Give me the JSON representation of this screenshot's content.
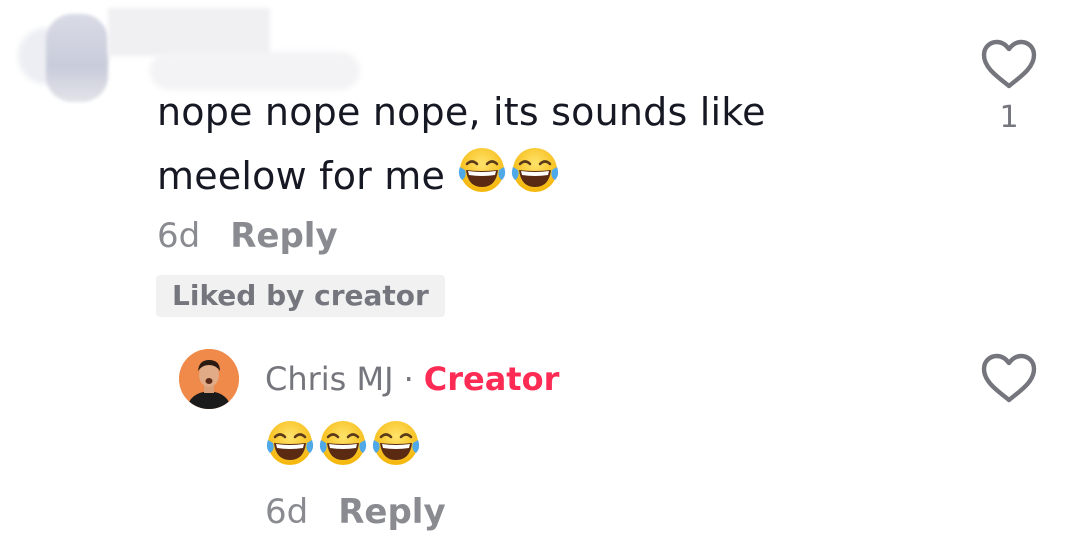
{
  "comment": {
    "text_line1": "nope nope nope, its sounds like",
    "text_line2": "meelow for me",
    "emojis": [
      "face-with-tears-of-joy",
      "face-with-tears-of-joy"
    ],
    "time": "6d",
    "reply_label": "Reply",
    "liked_badge": "Liked by creator",
    "like_count": "1"
  },
  "reply": {
    "author": "Chris MJ",
    "separator": "·",
    "role_badge": "Creator",
    "emojis": [
      "face-with-tears-of-joy",
      "face-with-tears-of-joy",
      "face-with-tears-of-joy"
    ],
    "time": "6d",
    "reply_label": "Reply"
  },
  "colors": {
    "text": "#161823",
    "muted": "#75767d",
    "creator_accent": "#fe2c55",
    "badge_bg": "#f1f1f2"
  },
  "icons": {
    "like": "heart-outline-icon",
    "emoji": "face-with-tears-of-joy"
  }
}
